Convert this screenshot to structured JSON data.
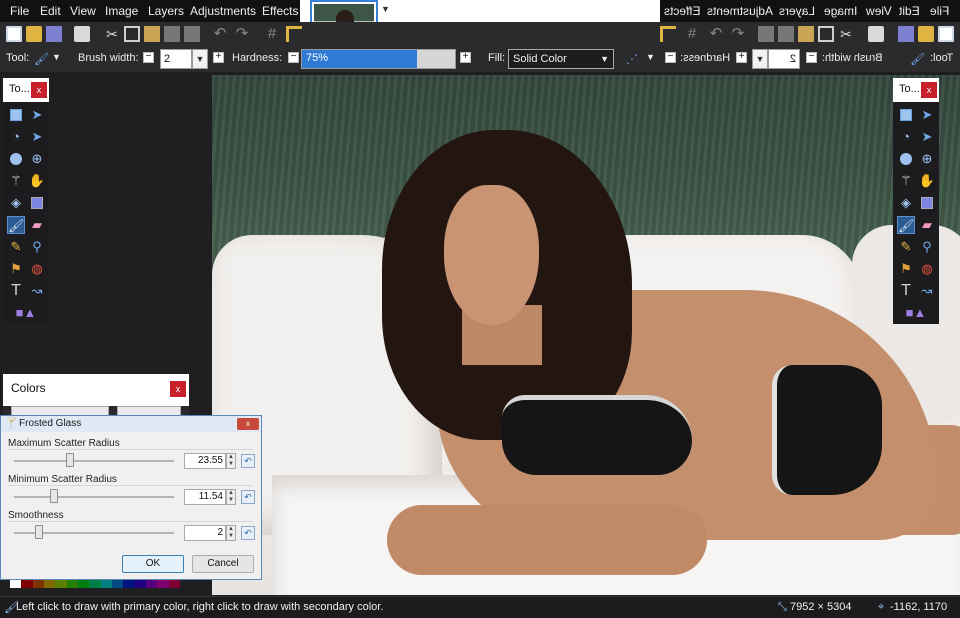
{
  "menu_left": [
    "File",
    "Edit",
    "View",
    "Image",
    "Layers",
    "Adjustments",
    "Effects"
  ],
  "menu_right_mirrored": [
    "File",
    "Edit",
    "View",
    "Image",
    "Layers",
    "Adjustments",
    "Effects"
  ],
  "options": {
    "tool_label": "Tool:",
    "brush_width_label": "Brush width:",
    "brush_width_value": "2",
    "hardness_label": "Hardness:",
    "hardness_value": "75%",
    "hardness_fraction": 0.75,
    "fill_label": "Fill:",
    "fill_value": "Solid Color",
    "mirror_tool_label": "Tool:",
    "mirror_brush_width_label": "Brush width:",
    "mirror_brush_width_value": "2",
    "mirror_hardness_label": "Hardness:"
  },
  "tools_left": {
    "title": "To...",
    "close": "x"
  },
  "tools_right": {
    "title": "To...",
    "close": "x"
  },
  "colors": {
    "title": "Colors",
    "close": "x"
  },
  "palette": [
    "#ffffff",
    "#7f0000",
    "#7f3300",
    "#7f6a00",
    "#5b7f00",
    "#267f00",
    "#007f0e",
    "#007f46",
    "#007f7f",
    "#004a7f",
    "#00137f",
    "#21007f",
    "#57007f",
    "#7f006e",
    "#7f0037"
  ],
  "dialog": {
    "title": "Frosted Glass",
    "close": "x",
    "max_label": "Maximum Scatter Radius",
    "max_value": "23.55",
    "min_label": "Minimum Scatter Radius",
    "min_value": "11.54",
    "smooth_label": "Smoothness",
    "smooth_value": "2",
    "ok": "OK",
    "cancel": "Cancel"
  },
  "status": {
    "hint": "Left click to draw with primary color, right click to draw with secondary color.",
    "image_size": "7952 × 5304",
    "cursor_pos": "-1162, 1170"
  },
  "colors_accent": {
    "selection": "#2f7ad4",
    "close": "#c8202a"
  }
}
